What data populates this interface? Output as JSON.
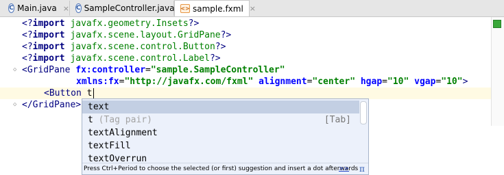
{
  "tabs": [
    {
      "label": "Main.java",
      "icon": "java-class-icon",
      "close": "×"
    },
    {
      "label": "SampleController.java",
      "icon": "java-class-icon",
      "close": "×"
    },
    {
      "label": "sample.fxml",
      "icon": "fxml-file-icon",
      "close": "×"
    }
  ],
  "active_tab": "sample.fxml",
  "code": {
    "l1": {
      "open": "<?",
      "kw": "import",
      "val": "javafx.geometry.Insets",
      "close": "?>"
    },
    "l2": {
      "open": "<?",
      "kw": "import",
      "val": "javafx.scene.layout.GridPane",
      "close": "?>"
    },
    "l3": {
      "open": "<?",
      "kw": "import",
      "val": "javafx.scene.control.Button",
      "close": "?>"
    },
    "l4": {
      "open": "<?",
      "kw": "import",
      "val": "javafx.scene.control.Label",
      "close": "?>"
    },
    "l5": {
      "tag": "<GridPane",
      "attr1": "fx:controller",
      "eq": "=",
      "str1": "\"sample.SampleController\""
    },
    "l6": {
      "attr2": "xmlns:fx",
      "str2": "\"http://javafx.com/fxml\"",
      "attr3": "alignment",
      "str3": "\"center\"",
      "attr4": "hgap",
      "str4": "\"10\"",
      "attr5": "vgap",
      "str5": "\"10\"",
      "end": ">"
    },
    "l7": {
      "tag": "<Button",
      "typed": "t"
    },
    "l8": {
      "tag": "</GridPane>"
    }
  },
  "completion": {
    "items": [
      {
        "match": "t",
        "rest": "ext",
        "tail": ""
      },
      {
        "match": "t",
        "rest": " (Tag pair)",
        "tail": "[Tab]"
      },
      {
        "match": "t",
        "rest": "extAlignment",
        "tail": ""
      },
      {
        "match": "t",
        "rest": "extFill",
        "tail": ""
      },
      {
        "match": "t",
        "rest": "extOverrun",
        "tail": ""
      }
    ],
    "hint": "Press Ctrl+Period to choose the selected (or first) suggestion and insert a dot afterwards",
    "hint_link": ">>",
    "pi": "π"
  },
  "colors": {
    "tag": "#000080",
    "attribute": "#0000ff",
    "string": "#008000",
    "selection": "#c3cfe3",
    "popup_bg": "#ecf1fb",
    "status_ok": "#39a839"
  }
}
